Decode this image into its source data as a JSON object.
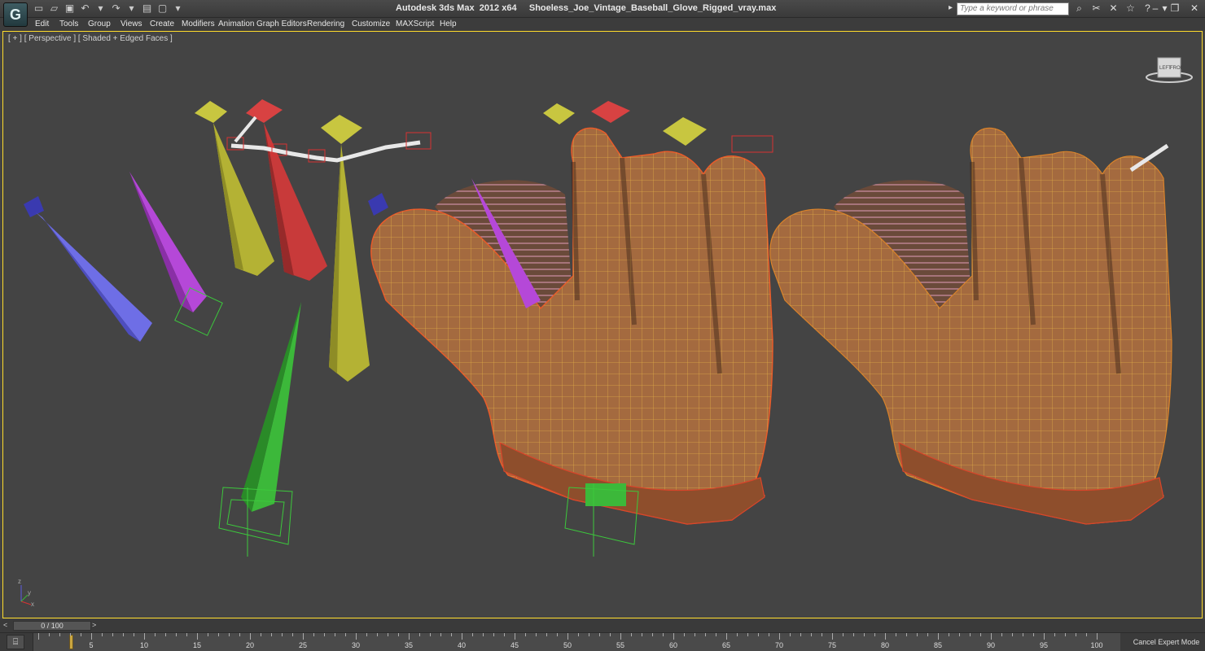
{
  "app": {
    "title": "Autodesk 3ds Max  2012 x64     Shoeless_Joe_Vintage_Baseball_Glove_Rigged_vray.max",
    "logo_glyph": "G"
  },
  "search": {
    "placeholder": "Type a keyword or phrase"
  },
  "menu": [
    {
      "label": "Edit"
    },
    {
      "label": "Tools"
    },
    {
      "label": "Group"
    },
    {
      "label": "Views"
    },
    {
      "label": "Create"
    },
    {
      "label": "Modifiers"
    },
    {
      "label": "Animation"
    },
    {
      "label": "Graph Editors"
    },
    {
      "label": "Rendering"
    },
    {
      "label": "Customize"
    },
    {
      "label": "MAXScript"
    },
    {
      "label": "Help"
    }
  ],
  "viewport": {
    "label": "[ + ] [ Perspective ] [ Shaded + Edged Faces ]",
    "border_color": "#ffdc2b",
    "background": "#444444",
    "axis": {
      "z": "z",
      "x": "x",
      "y": "y"
    },
    "viewcube": {
      "left": "LEFT",
      "front": "FRONT"
    }
  },
  "timeslider": {
    "frame": "0 / 100"
  },
  "timeline": {
    "ticks": [
      "5",
      "10",
      "15",
      "20",
      "25",
      "30",
      "35",
      "40",
      "45",
      "50",
      "55",
      "60",
      "65",
      "70",
      "75",
      "80",
      "85",
      "90",
      "95",
      "100"
    ],
    "cursor_frame": 0,
    "cancel_label": "Cancel Expert Mode"
  },
  "colors": {
    "glove": "#a46a3f",
    "wire": "#e3b23c",
    "bone_yellow": "#b8b63a",
    "bone_red": "#c83a3a",
    "bone_green": "#3cb83a",
    "bone_blue": "#5c5ce0",
    "bone_purple": "#b43ad2"
  }
}
